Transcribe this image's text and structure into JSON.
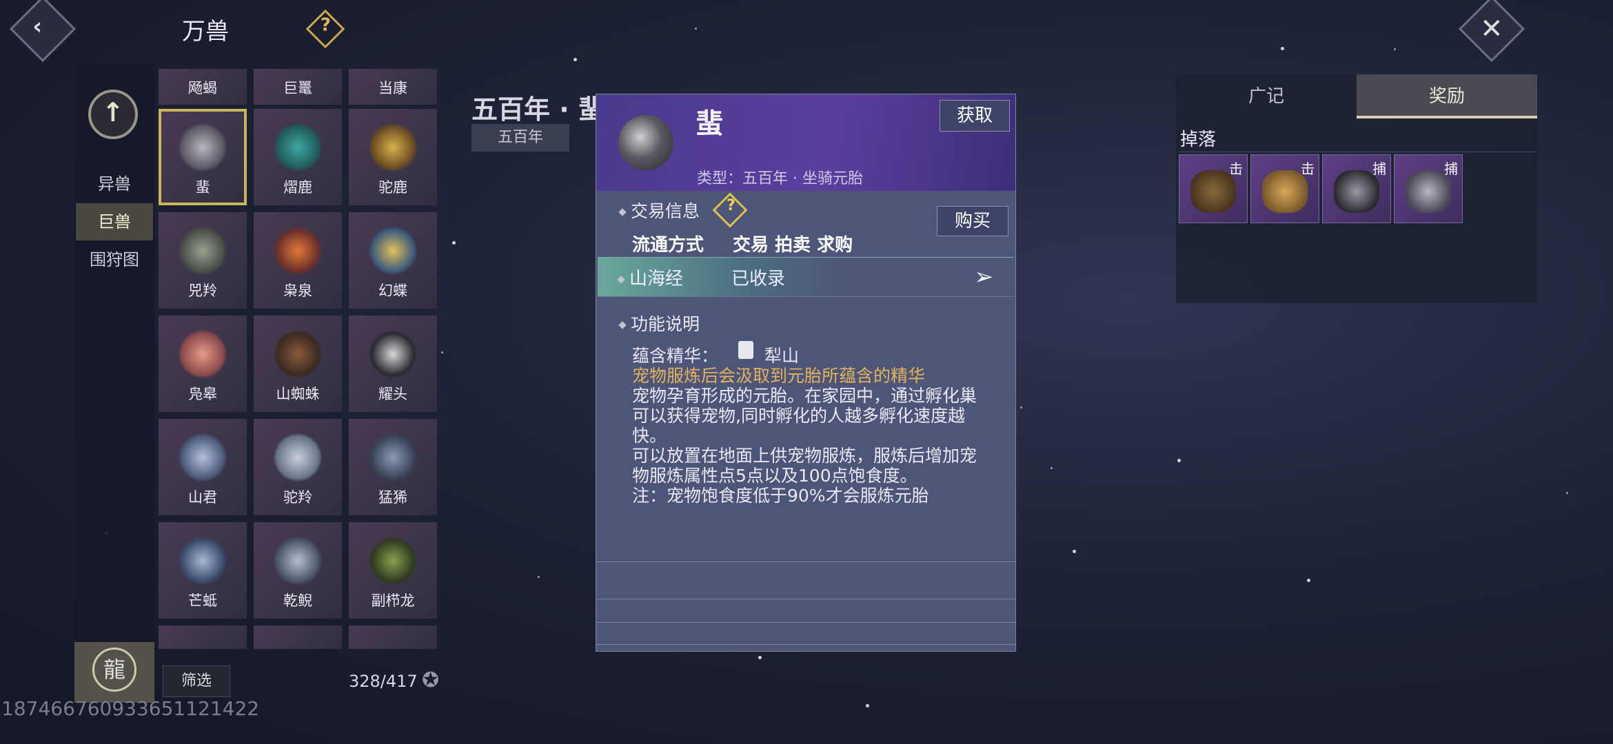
{
  "header": {
    "title": "万兽",
    "help_icon": "question-diamond-icon",
    "back_icon": "chevron-left-icon",
    "close_icon": "close-x-icon"
  },
  "sidebar": {
    "up_icon": "arrow-up-icon",
    "tabs": [
      {
        "label": "异兽",
        "active": false
      },
      {
        "label": "巨兽",
        "active": true
      },
      {
        "label": "围狩图",
        "active": false
      }
    ],
    "avatar_icon": "dragon-avatar-icon"
  },
  "grid": {
    "top_row_partial": [
      "飏蝎",
      "巨鼍",
      "当康"
    ],
    "rows": [
      [
        "蜚",
        "熠鹿",
        "驼鹿"
      ],
      [
        "兕羚",
        "枭泉",
        "幻蝶"
      ],
      [
        "凫皋",
        "山蜘蛛",
        "耀头"
      ],
      [
        "山君",
        "驼羚",
        "猛狶"
      ],
      [
        "芒蚳",
        "乾鲵",
        "副栉龙"
      ]
    ],
    "selected": "蜚",
    "filter_label": "筛选",
    "count": "328/417"
  },
  "background_title": {
    "title": "五百年 · 蜚",
    "tag": "五百年"
  },
  "popup": {
    "name": "蜚",
    "type_line": "类型：五百年 · 坐骑元胎",
    "obtain_label": "获取",
    "trade_title": "交易信息",
    "buy_label": "购买",
    "circulation_label": "流通方式",
    "circulation_value": "交易 拍卖 求购",
    "shanhai_label": "山海经",
    "shanhai_status": "已收录",
    "func_title": "功能说明",
    "essence_label": "蕴含精华：",
    "essence_value": "犁山",
    "desc_highlight": "宠物服炼后会汲取到元胎所蕴含的精华",
    "desc_1": "宠物孕育形成的元胎。在家园中，通过孵化巢可以获得宠物,同时孵化的人越多孵化速度越快。",
    "desc_2": "可以放置在地面上供宠物服炼，服炼后增加宠物服炼属性点5点以及100点饱食度。",
    "desc_3": "注：宠物饱食度低于90%才会服炼元胎"
  },
  "right_panel": {
    "tabs": [
      {
        "label": "广记",
        "active": false
      },
      {
        "label": "奖励",
        "active": true
      }
    ],
    "drop_title": "掉落",
    "drops": [
      {
        "tag": "击"
      },
      {
        "tag": "击"
      },
      {
        "tag": "捕"
      },
      {
        "tag": "捕"
      }
    ]
  },
  "watermark": "18746676093365112142​2"
}
